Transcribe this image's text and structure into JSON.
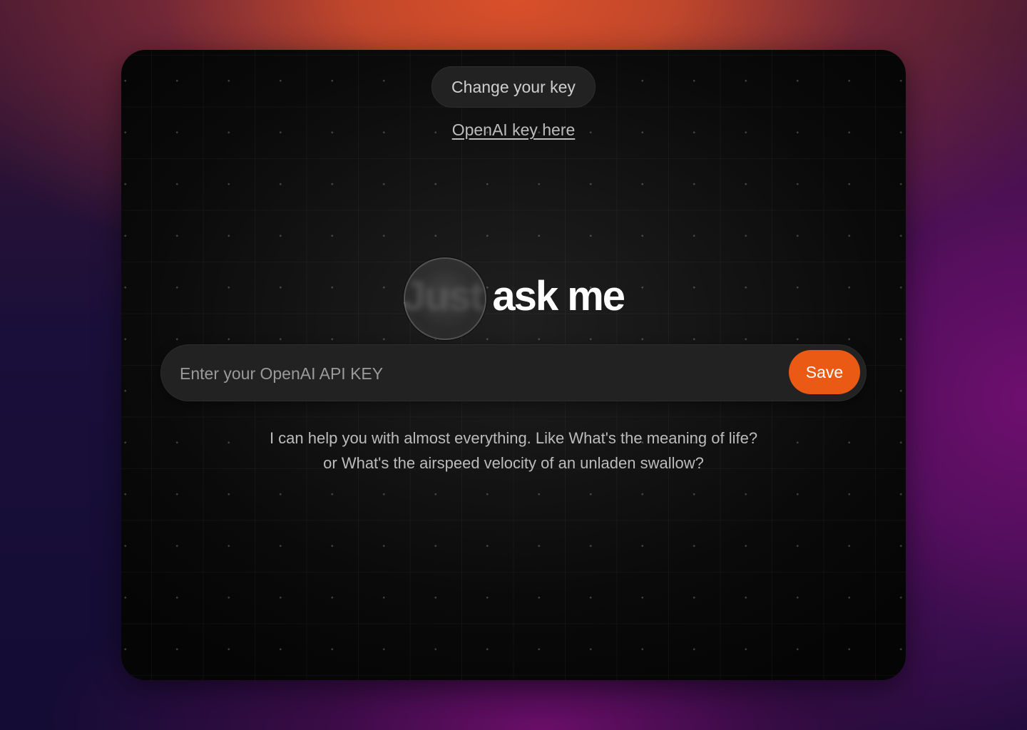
{
  "header": {
    "change_key_label": "Change your key",
    "key_link_label": "OpenAI key here"
  },
  "hero": {
    "title": "Just ask me"
  },
  "api_key_form": {
    "input_placeholder": "Enter your OpenAI API KEY",
    "input_value": "",
    "save_label": "Save"
  },
  "helper_text": {
    "line1": "I can help you with almost everything. Like What's the meaning of life?",
    "line2": "or What's the airspeed velocity of an unladen swallow?"
  },
  "colors": {
    "accent": "#ea5a14",
    "card_background": "#0a0a0a",
    "pill_background": "#222222"
  }
}
